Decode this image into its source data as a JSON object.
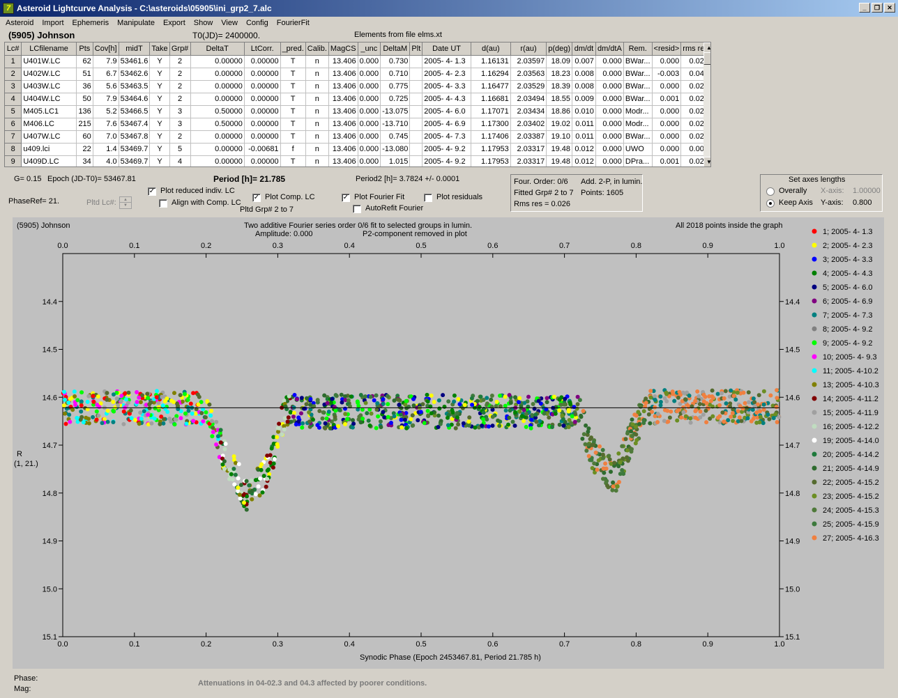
{
  "window": {
    "title": "Asteroid Lightcurve Analysis - C:\\asteroids\\05905\\ini_grp2_7.alc",
    "icon": "7",
    "minimize": "_",
    "restore": "❐",
    "close": "✕"
  },
  "menu": [
    "Asteroid",
    "Import",
    "Ephemeris",
    "Manipulate",
    "Export",
    "Show",
    "View",
    "Config",
    "FourierFit"
  ],
  "header": {
    "asteroid": "(5905) Johnson",
    "t0": "T0(JD)= 2400000.",
    "elements": "Elements from file elms.xt"
  },
  "table": {
    "columns": [
      "Lc#",
      "LCfilename",
      "Pts",
      "Cov[h]",
      "midT",
      "Take",
      "Grp#",
      "DeltaT",
      "LtCorr.",
      "_pred.",
      "Calib.",
      "MagCS",
      "_unc",
      "DeltaM",
      "Plt",
      "Date UT",
      "d(au)",
      "r(au)",
      "p(deg)",
      "dm/dt",
      "dm/dtA",
      "Rem.",
      "<resid>",
      "rms res"
    ],
    "rows": [
      [
        "1",
        "U401W.LC",
        "62",
        "7.9",
        "53461.6",
        "Y",
        "2",
        "0.00000",
        "0.00000",
        "T",
        "n",
        "13.406",
        "0.000",
        "0.730",
        "",
        "2005- 4- 1.3",
        "1.16131",
        "2.03597",
        "18.09",
        "0.007",
        "0.000",
        "BWar...",
        "0.000",
        "0.027"
      ],
      [
        "2",
        "U402W.LC",
        "51",
        "6.7",
        "53462.6",
        "Y",
        "2",
        "0.00000",
        "0.00000",
        "T",
        "n",
        "13.406",
        "0.000",
        "0.710",
        "",
        "2005- 4- 2.3",
        "1.16294",
        "2.03563",
        "18.23",
        "0.008",
        "0.000",
        "BWar...",
        "-0.003",
        "0.041"
      ],
      [
        "3",
        "U403W.LC",
        "36",
        "5.6",
        "53463.5",
        "Y",
        "2",
        "0.00000",
        "0.00000",
        "T",
        "n",
        "13.406",
        "0.000",
        "0.775",
        "",
        "2005- 4- 3.3",
        "1.16477",
        "2.03529",
        "18.39",
        "0.008",
        "0.000",
        "BWar...",
        "0.000",
        "0.022"
      ],
      [
        "4",
        "U404W.LC",
        "50",
        "7.9",
        "53464.6",
        "Y",
        "2",
        "0.00000",
        "0.00000",
        "T",
        "n",
        "13.406",
        "0.000",
        "0.725",
        "",
        "2005- 4- 4.3",
        "1.16681",
        "2.03494",
        "18.55",
        "0.009",
        "0.000",
        "BWar...",
        "0.001",
        "0.028"
      ],
      [
        "5",
        "M405.LC1",
        "136",
        "5.2",
        "53466.5",
        "Y",
        "3",
        "0.50000",
        "0.00000",
        "T",
        "n",
        "13.406",
        "0.000",
        "-13.075",
        "",
        "2005- 4- 6.0",
        "1.17071",
        "2.03434",
        "18.86",
        "0.010",
        "0.000",
        "Modr...",
        "0.000",
        "0.024"
      ],
      [
        "6",
        "M406.LC",
        "215",
        "7.6",
        "53467.4",
        "Y",
        "3",
        "0.50000",
        "0.00000",
        "T",
        "n",
        "13.406",
        "0.000",
        "-13.710",
        "",
        "2005- 4- 6.9",
        "1.17300",
        "2.03402",
        "19.02",
        "0.011",
        "0.000",
        "Modr...",
        "0.000",
        "0.021"
      ],
      [
        "7",
        "U407W.LC",
        "60",
        "7.0",
        "53467.8",
        "Y",
        "2",
        "0.00000",
        "0.00000",
        "T",
        "n",
        "13.406",
        "0.000",
        "0.745",
        "",
        "2005- 4- 7.3",
        "1.17406",
        "2.03387",
        "19.10",
        "0.011",
        "0.000",
        "BWar...",
        "0.000",
        "0.027"
      ],
      [
        "8",
        "u409.lci",
        "22",
        "1.4",
        "53469.7",
        "Y",
        "5",
        "0.00000",
        "-0.00681",
        "f",
        "n",
        "13.406",
        "0.000",
        "-13.080",
        "",
        "2005- 4- 9.2",
        "1.17953",
        "2.03317",
        "19.48",
        "0.012",
        "0.000",
        "UWO",
        "0.000",
        "0.008"
      ],
      [
        "9",
        "U409D.LC",
        "34",
        "4.0",
        "53469.7",
        "Y",
        "4",
        "0.00000",
        "0.00000",
        "T",
        "n",
        "13.406",
        "0.000",
        "1.015",
        "",
        "2005- 4- 9.2",
        "1.17953",
        "2.03317",
        "19.48",
        "0.012",
        "0.000",
        "DPra...",
        "0.001",
        "0.029"
      ]
    ]
  },
  "info": {
    "g": "G= 0.15",
    "epoch": "Epoch (JD-T0)= 53467.81",
    "period": "Period [h]= 21.785",
    "period2": "Period2 [h]= 3.7824 +/- 0.0001",
    "phaseref": "PhaseRef= 21.",
    "pltdlc": "Pltd Lc#:",
    "plot_reduced": "Plot reduced indiv. LC",
    "align": "Align with Comp. LC",
    "plot_comp": "Plot Comp. LC",
    "pltd_grp": "Pltd Grp#  2   to   7",
    "plot_fourier": "Plot Fourier Fit",
    "autorefit": "AutoRefit Fourier",
    "plot_residuals": "Plot residuals",
    "four_order": "Four. Order:  0/6",
    "add2p": "Add. 2-P, in lumin.",
    "fitted": "Fitted Grp# 2 to 7",
    "points": "Points: 1605",
    "rms": "Rms res     = 0.026"
  },
  "axes_box": {
    "title": "Set axes lengths",
    "overall": "Overally",
    "keep": "Keep Axis",
    "xaxis": "X-axis:",
    "xval": "1.00000",
    "yaxis": "Y-axis:",
    "yval": "0.800"
  },
  "plot_text": {
    "name": "(5905) Johnson",
    "line1": "Two additive Fourier series order 0/6 fit to selected groups in lumin.",
    "line2": "Amplitude: 0.000",
    "line3": "P2-component removed in plot",
    "inside": "All 2018 points inside the graph",
    "ylabel": "R",
    "ylabel2": "(1, 21.)",
    "xlabel": "Synodic Phase (Epoch 2453467.81, Period 21.785 h)"
  },
  "footer": {
    "phase": "Phase:",
    "mag": "Mag:",
    "note": "Attenuations in 04-02.3 and 04.3 affected by poorer conditions."
  },
  "chart_data": {
    "type": "scatter",
    "xlim": [
      0.0,
      1.0
    ],
    "ylim": [
      14.3,
      15.1
    ],
    "y_inverted": true,
    "xticks": [
      "0.0",
      "0.1",
      "0.2",
      "0.3",
      "0.4",
      "0.5",
      "0.6",
      "0.7",
      "0.8",
      "0.9",
      "1.0"
    ],
    "yticks": [
      "14.4",
      "14.5",
      "14.6",
      "14.7",
      "14.8",
      "14.9",
      "15.0",
      "15.1"
    ],
    "fit_line_y": 14.622,
    "legend": [
      {
        "label": "1; 2005- 4- 1.3",
        "color": "#ff0000"
      },
      {
        "label": "2; 2005- 4- 2.3",
        "color": "#ffff00"
      },
      {
        "label": "3; 2005- 4- 3.3",
        "color": "#0000ff"
      },
      {
        "label": "4; 2005- 4- 4.3",
        "color": "#008000"
      },
      {
        "label": "5; 2005- 4- 6.0",
        "color": "#000080"
      },
      {
        "label": "6; 2005- 4- 6.9",
        "color": "#800080"
      },
      {
        "label": "7; 2005- 4- 7.3",
        "color": "#008080"
      },
      {
        "label": "8; 2005- 4- 9.2",
        "color": "#808080"
      },
      {
        "label": "9; 2005- 4- 9.2",
        "color": "#00ff00"
      },
      {
        "label": "10; 2005- 4- 9.3",
        "color": "#ff00ff"
      },
      {
        "label": "11; 2005- 4-10.2",
        "color": "#00ffff"
      },
      {
        "label": "13; 2005- 4-10.3",
        "color": "#808000"
      },
      {
        "label": "14; 2005- 4-11.2",
        "color": "#800000"
      },
      {
        "label": "15; 2005- 4-11.9",
        "color": "#a0a0a0"
      },
      {
        "label": "16; 2005- 4-12.2",
        "color": "#c0dcc0"
      },
      {
        "label": "19; 2005- 4-14.0",
        "color": "#ffffff"
      },
      {
        "label": "20; 2005- 4-14.2",
        "color": "#1e7a3c"
      },
      {
        "label": "21; 2005- 4-14.9",
        "color": "#2e6b2e"
      },
      {
        "label": "22; 2005- 4-15.2",
        "color": "#556b2f"
      },
      {
        "label": "23; 2005- 4-15.2",
        "color": "#6b8e23"
      },
      {
        "label": "24; 2005- 4-15.3",
        "color": "#4f7a3a"
      },
      {
        "label": "25; 2005- 4-15.9",
        "color": "#3d7a3d"
      },
      {
        "label": "27; 2005- 4-16.3",
        "color": "#f08040"
      }
    ],
    "lightcurve_shape": [
      [
        0.0,
        14.622
      ],
      [
        0.2,
        14.622
      ],
      [
        0.225,
        14.72
      ],
      [
        0.26,
        14.81
      ],
      [
        0.29,
        14.74
      ],
      [
        0.31,
        14.63
      ],
      [
        0.72,
        14.63
      ],
      [
        0.74,
        14.72
      ],
      [
        0.77,
        14.77
      ],
      [
        0.8,
        14.66
      ],
      [
        0.82,
        14.62
      ],
      [
        1.0,
        14.62
      ]
    ]
  }
}
